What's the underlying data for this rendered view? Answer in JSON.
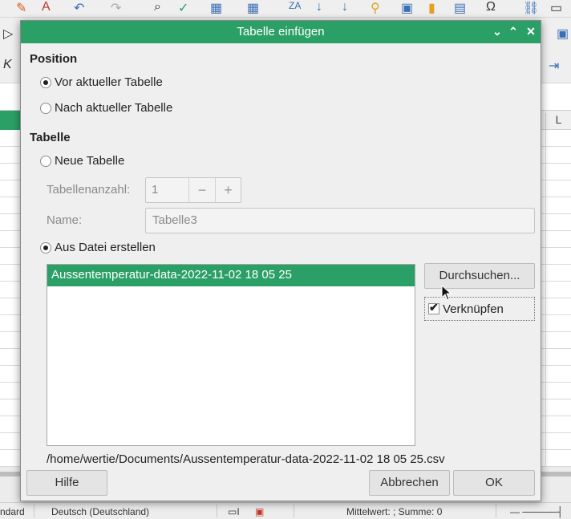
{
  "background": {
    "column_letter": "L",
    "toolbar_icons": [
      "paintbrush-icon",
      "eraser-icon",
      "undo-icon",
      "redo-icon",
      "find-replace-icon",
      "spellcheck-icon",
      "table-icon",
      "sort-ascending-icon",
      "sort-descending-icon",
      "chart-icon",
      "special-character-icon",
      "link-icon"
    ],
    "status": {
      "style": "ndard",
      "language": "Deutsch (Deutschland)",
      "summary": "Mittelwert: ; Summe: 0"
    }
  },
  "dialog": {
    "title": "Tabelle einfügen",
    "position": {
      "heading": "Position",
      "before_label": "Vor aktueller Tabelle",
      "after_label": "Nach aktueller Tabelle",
      "selected": "before"
    },
    "table": {
      "heading": "Tabelle",
      "new_label": "Neue Tabelle",
      "count_label": "Tabellenanzahl:",
      "count_value": "1",
      "name_label": "Name:",
      "name_value": "Tabelle3",
      "from_file_label": "Aus Datei erstellen",
      "selected": "from_file"
    },
    "files": [
      "Aussentemperatur-data-2022-11-02 18 05 25"
    ],
    "browse_label": "Durchsuchen...",
    "link_label": "Verknüpfen",
    "link_checked": true,
    "file_path": "/home/wertie/Documents/Aussentemperatur-data-2022-11-02 18 05 25.csv",
    "buttons": {
      "help": "Hilfe",
      "cancel": "Abbrechen",
      "ok": "OK"
    },
    "accent_color": "#2ba066"
  }
}
